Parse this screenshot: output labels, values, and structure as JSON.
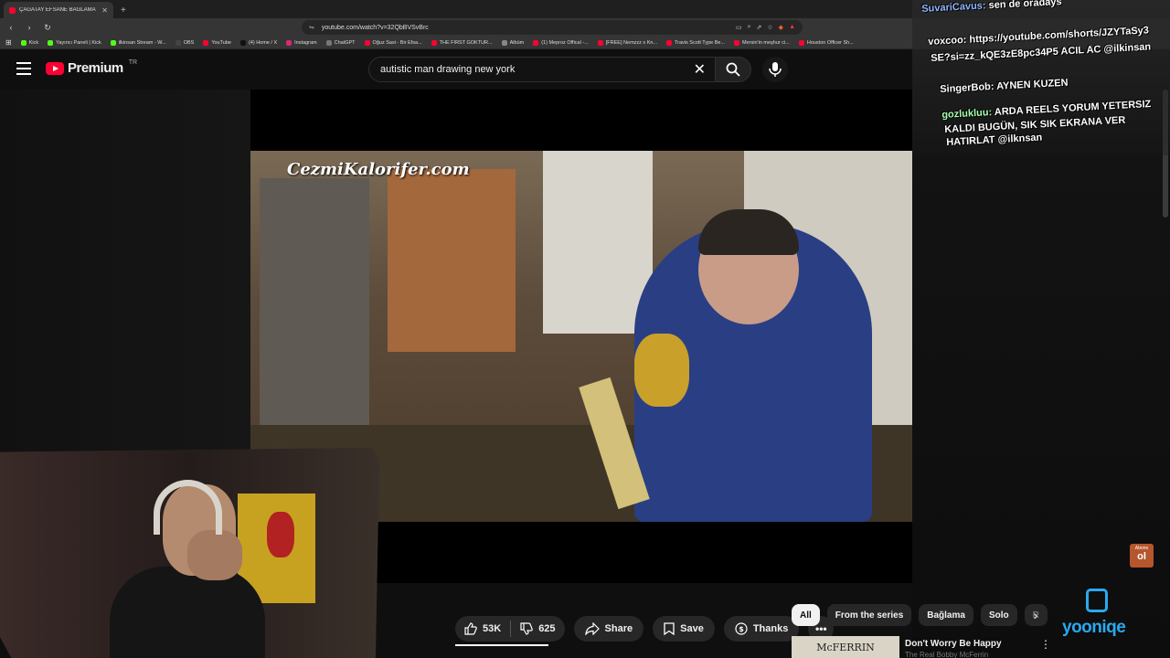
{
  "browser": {
    "tab_title": "ÇAĞATAY EFSANE BAĞLAMA",
    "url": "youtube.com/watch?v=32QbBVSvBrc",
    "bookmarks": [
      {
        "label": "Kick",
        "color": "#53fc18"
      },
      {
        "label": "Yayıncı Paneli | Kick",
        "color": "#53fc18"
      },
      {
        "label": "ilkinsan Stream - W...",
        "color": "#53fc18"
      },
      {
        "label": "OBS",
        "color": "#444444"
      },
      {
        "label": "YouTube",
        "color": "#ff0033"
      },
      {
        "label": "(4) Home / X",
        "color": "#111111"
      },
      {
        "label": "Instagram",
        "color": "#d62976"
      },
      {
        "label": "ChatGPT",
        "color": "#777777"
      },
      {
        "label": "Oğuz Sasi - Bir Efsa...",
        "color": "#ff0033"
      },
      {
        "label": "THE FIRST GOKTUR...",
        "color": "#ff0033"
      },
      {
        "label": "Albüm",
        "color": "#888888"
      },
      {
        "label": "(1) Meproz Offical -...",
        "color": "#ff0033"
      },
      {
        "label": "[FREE] Nemzzz x Kn...",
        "color": "#ff0033"
      },
      {
        "label": "Travis Scott Type Be...",
        "color": "#ff0033"
      },
      {
        "label": "Mersin'in meşhur ci...",
        "color": "#ff0033"
      },
      {
        "label": "Houston Officer Sh...",
        "color": "#ff0033"
      }
    ]
  },
  "youtube": {
    "logo_text": "Premium",
    "region": "TR",
    "search_value": "autistic man drawing new york",
    "watermark": "CezmiKalorifer.com"
  },
  "chat": [
    {
      "user": "SuvariCavus:",
      "text": "sen de oradays",
      "color": "#8fb8ff"
    },
    {
      "user": "voxcoo:",
      "text": "https://youtube.com/shorts/JZYTaSy3",
      "color": "#ffffff"
    },
    {
      "user": "",
      "text": "SE?si=zz_kQE3zE8pc34P5 ACIL AC @ilkinsan",
      "color": "#ffffff"
    },
    {
      "user": "SingerBob:",
      "text": "AYNEN KUZEN",
      "color": "#ffffff"
    },
    {
      "user": "gozlukluu:",
      "text": "ARDA REELS YORUM YETERSIZ",
      "color": "#a9ffb0"
    },
    {
      "user": "",
      "text": "KALDI BUGÜN, SIK SIK EKRANA VER",
      "color": "#ffffff"
    },
    {
      "user": "",
      "text": "HATIRLAT @ilknsan",
      "color": "#ffffff"
    }
  ],
  "actions": {
    "likes": "53K",
    "dislikes": "625",
    "share": "Share",
    "save": "Save",
    "thanks": "Thanks",
    "more": "•••"
  },
  "chips": [
    "All",
    "From the series",
    "Bağlama",
    "Solo",
    "R"
  ],
  "recommendation": {
    "title": "Don't Worry Be Happy",
    "channel": "The Real Bobby McFerrin",
    "thumb_text": "McFERRIN"
  },
  "overlay": {
    "abone_top": "Abone",
    "abone_main": "ol",
    "brand": "yooniqe"
  }
}
